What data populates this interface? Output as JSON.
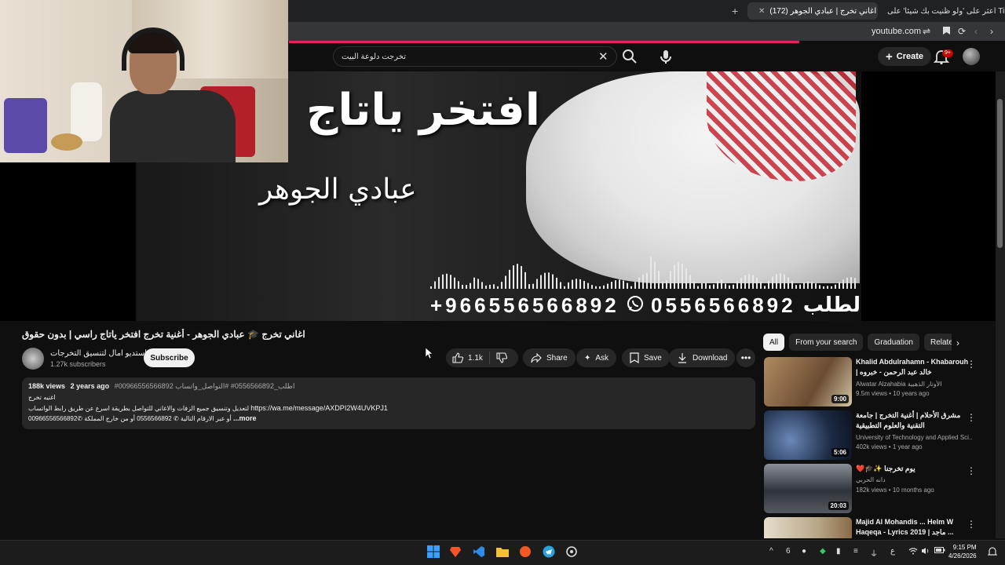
{
  "browser": {
    "tabs": [
      {
        "label": "اعثر على 'ولو ظنيت بك شيئا' على TikTok",
        "active": false
      },
      {
        "label": "(172) اغاني تخرج | عبادي الجوهر",
        "active": true
      }
    ],
    "url": "youtube.com",
    "accent": "#e0245e"
  },
  "youtube": {
    "search_query": "تخرجت دلوعة البيت",
    "create_label": "Create",
    "notif_count": "9+"
  },
  "video": {
    "overlay_title": "افتخر ياتاج",
    "overlay_artist": "عبادي الجوهر",
    "overlay_phone": "+966556566892",
    "overlay_phone2": "0556566892",
    "overlay_label": "لطلب"
  },
  "watch": {
    "title": "اغاني تخرج 🎓 عبادي الجوهر - أغنية تخرج افتخر ياتاج راسي | بدون حقوق",
    "channel_name": "استديو امال لتنسيق التخرجات",
    "subscribers": "1.27k subscribers",
    "subscribe_label": "Subscribe",
    "like_count": "1.1k",
    "share_label": "Share",
    "ask_label": "Ask",
    "save_label": "Save",
    "download_label": "Download",
    "views": "188k views",
    "age": "2 years ago",
    "tags": "#اطلب_0556566892# #التواصل_واتساب 00966556566892",
    "desc_line1": "اغنيه تخرج",
    "desc_line2": "لتعديل وتنسيق جميع الزفات والاغاني للتواصل بطريقة اسرع عن طريق رابط الواتساب",
    "desc_link": "https://wa.me/message/AXDPI2W4UVKPJ1",
    "desc_line3_a": "أو عبر الارقام التالية ✆ 0556566892  أو من خارج المملكة ✆00966556566892",
    "more_label": "...more"
  },
  "sidebar": {
    "chips": [
      "All",
      "From your search",
      "Graduation",
      "Related"
    ],
    "items": [
      {
        "title": "Khalid Abdulrahamn - Khabarouh | خالد عبد الرحمن - خبروه",
        "channel": "Alwatar Alzahabia الأوتار الذهبية",
        "meta": "9.5m views • 10 years ago",
        "duration": "9:00",
        "thumb": "#8a6a48"
      },
      {
        "title": "مشرق الأحلام | أغنية التخرج | جامعة التقنية والعلوم التطبيقية",
        "channel": "University of Technology and Applied Sci...",
        "meta": "402k views • 1 year ago",
        "duration": "5:06",
        "thumb": "#1c2a44"
      },
      {
        "title": "❤️🎓✨ يوم تخرجنا",
        "channel": "دانه الحربي",
        "meta": "182k views • 10 months ago",
        "duration": "20:03",
        "thumb": "#3a3f48"
      },
      {
        "title": "Majid Al Mohandis ... Helm W Haqeqa - Lyrics 2019 | ماجد ...",
        "channel": "",
        "meta": "",
        "duration": "",
        "thumb": "#c9c0b0"
      }
    ]
  },
  "taskbar": {
    "time": "9:15 PM",
    "date": "4/26/2026",
    "lang": "ع",
    "weather": "6"
  }
}
